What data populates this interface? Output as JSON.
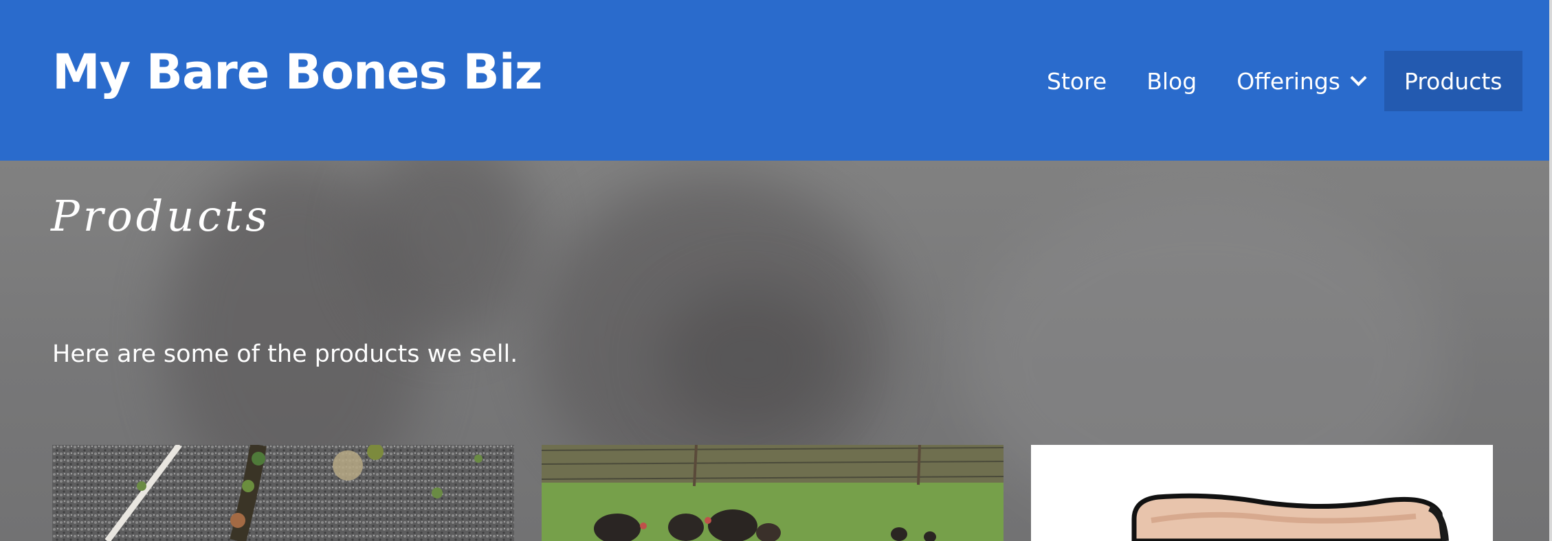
{
  "header": {
    "site_title": "My Bare Bones Biz",
    "nav": [
      {
        "label": "Store"
      },
      {
        "label": "Blog"
      },
      {
        "label": "Offerings",
        "has_dropdown": true
      },
      {
        "label": "Products",
        "active": true
      }
    ]
  },
  "page": {
    "heading": "Products",
    "intro": "Here are some of the products we sell."
  },
  "colors": {
    "header_bg": "#2a6bcc",
    "active_nav_bg": "#235ab0",
    "text": "#ffffff"
  },
  "icons": {
    "offerings_dropdown": "chevron-down-icon"
  }
}
